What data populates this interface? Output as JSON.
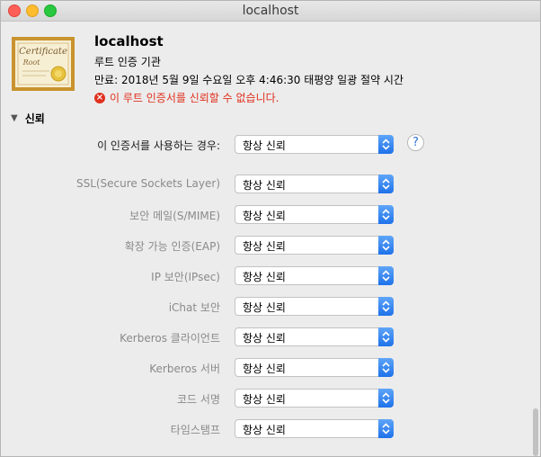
{
  "window": {
    "title": "localhost"
  },
  "certificate": {
    "image_text": "Certificate Root",
    "name": "localhost",
    "type": "루트 인증 기관",
    "expires": "만료: 2018년 5월 9일 수요일 오후 4:46:30 태평양 일광 절약 시간",
    "error": "이 루트 인증서를 신뢰할 수 없습니다."
  },
  "trust": {
    "heading": "신뢰",
    "main_label": "이 인증서를 사용하는 경우:",
    "main_value": "항상 신뢰",
    "help": "?",
    "rows": [
      {
        "label": "SSL(Secure Sockets Layer)",
        "value": "항상 신뢰"
      },
      {
        "label": "보안 메일(S/MIME)",
        "value": "항상 신뢰"
      },
      {
        "label": "확장 가능 인증(EAP)",
        "value": "항상 신뢰"
      },
      {
        "label": "IP 보안(IPsec)",
        "value": "항상 신뢰"
      },
      {
        "label": "iChat 보안",
        "value": "항상 신뢰"
      },
      {
        "label": "Kerberos 클라이언트",
        "value": "항상 신뢰"
      },
      {
        "label": "Kerberos 서버",
        "value": "항상 신뢰"
      },
      {
        "label": "코드 서명",
        "value": "항상 신뢰"
      },
      {
        "label": "타임스탬프",
        "value": "항상 신뢰"
      }
    ]
  }
}
